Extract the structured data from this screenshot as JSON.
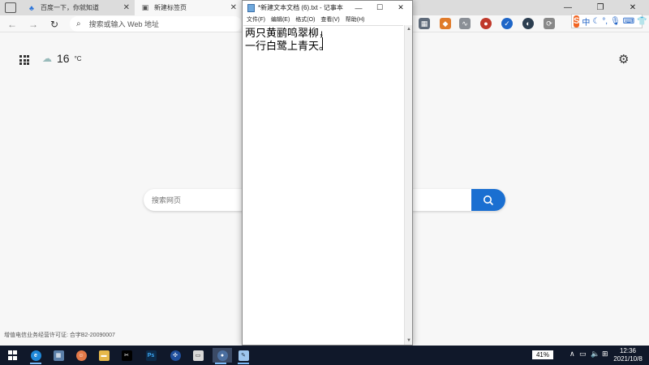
{
  "browser": {
    "tabs": [
      {
        "label": "百度一下，你就知道"
      },
      {
        "label": "新建标签页"
      }
    ],
    "address_placeholder": "搜索或输入 Web 地址"
  },
  "ime": {
    "logo": "S",
    "lang": "中",
    "punct": "°,"
  },
  "newtab": {
    "weather": {
      "temp": "16",
      "unit": "°C"
    },
    "search_placeholder": "搜索网页",
    "footer": "增值电信业务经营许可证: 合字B2-20090007"
  },
  "notepad": {
    "title": "*新建文本文档 (6).txt - 记事本",
    "menu": [
      "文件(F)",
      "编辑(E)",
      "格式(O)",
      "查看(V)",
      "帮助(H)"
    ],
    "lines": [
      "两只黄鹂鸣翠柳，",
      "一行白鹭上青天。"
    ]
  },
  "taskbar": {
    "battery": "41%",
    "time": "12:36",
    "date": "2021/10/8"
  },
  "colors": {
    "search_button": "#1a6fd1",
    "taskbar": "#10182a",
    "ime_logo": "#f26522"
  }
}
